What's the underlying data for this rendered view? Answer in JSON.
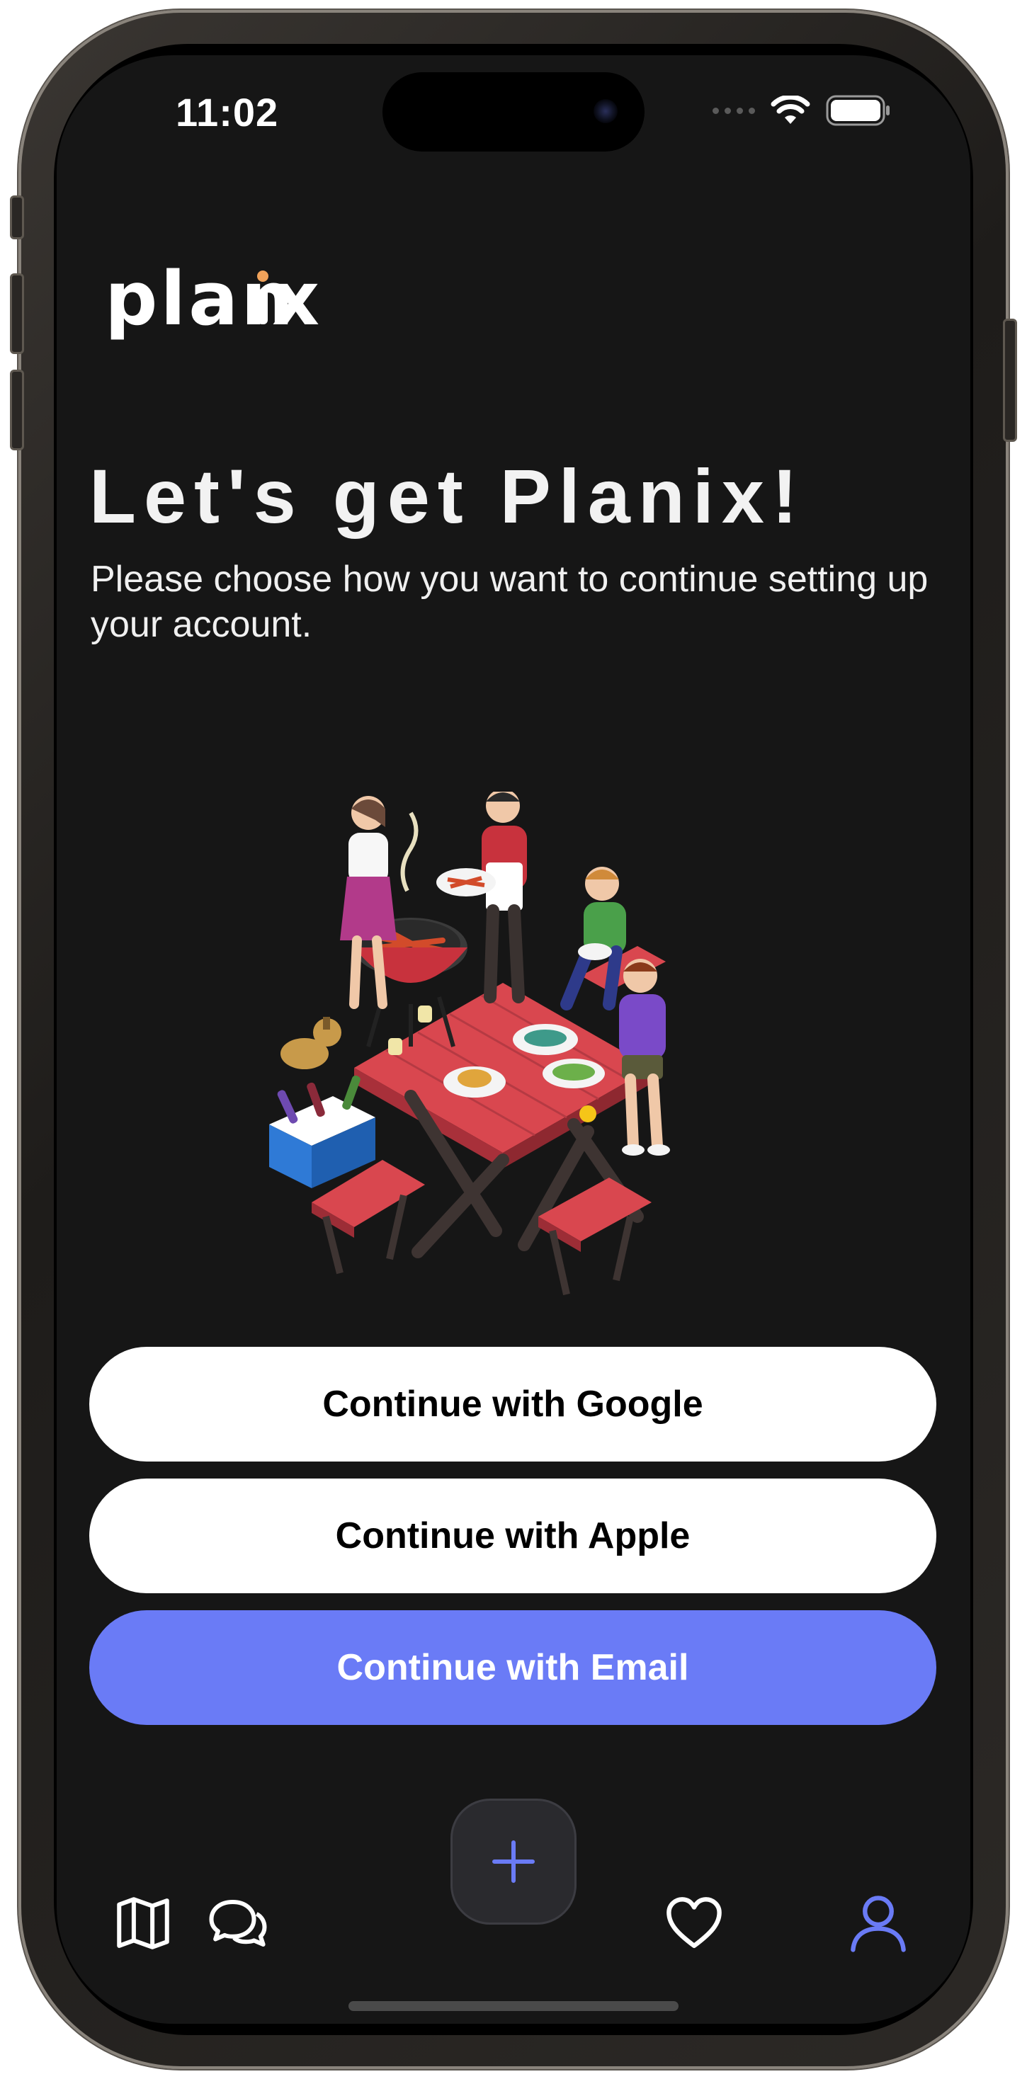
{
  "status_bar": {
    "time": "11:02"
  },
  "app": {
    "logo_text": "planix",
    "logo_dot_color": "#f0a25a"
  },
  "onboarding": {
    "title": "Let's get Planix!",
    "subtitle": "Please choose how you want to continue setting up your account."
  },
  "illustration": {
    "icon": "picnic-bbq-illustration"
  },
  "auth_buttons": {
    "google_label": "Continue with Google",
    "apple_label": "Continue with Apple",
    "email_label": "Continue with Email"
  },
  "tab_bar": {
    "items": [
      {
        "icon": "map-icon",
        "active": false
      },
      {
        "icon": "chat-bubbles-icon",
        "active": false
      },
      {
        "icon": "plus-icon",
        "active": false
      },
      {
        "icon": "heart-icon",
        "active": false
      },
      {
        "icon": "user-icon",
        "active": true
      }
    ],
    "active_color": "#6a7bf6",
    "inactive_color": "#ffffff"
  },
  "colors": {
    "background": "#161616",
    "accent": "#6a7bf6",
    "text_primary": "#f2f2f2"
  }
}
